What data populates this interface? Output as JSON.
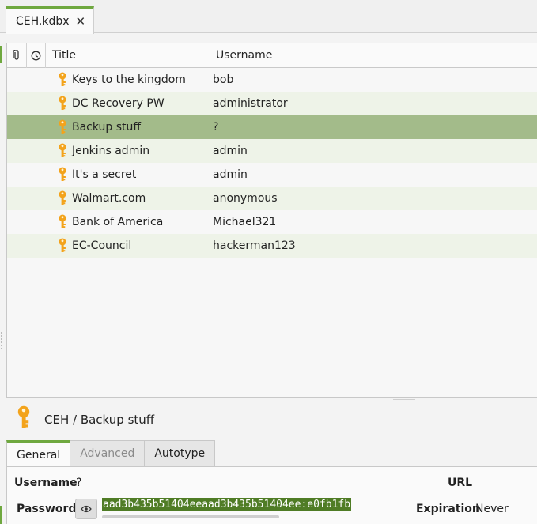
{
  "tab": {
    "title": "CEH.kdbx",
    "close_glyph": "✕"
  },
  "table": {
    "headers": {
      "title": "Title",
      "username": "Username"
    },
    "rows": [
      {
        "title": "Keys to the kingdom",
        "username": "bob"
      },
      {
        "title": "DC Recovery PW",
        "username": "administrator"
      },
      {
        "title": "Backup stuff",
        "username": "?"
      },
      {
        "title": "Jenkins admin",
        "username": "admin"
      },
      {
        "title": "It's a secret",
        "username": "admin"
      },
      {
        "title": "Walmart.com",
        "username": "anonymous"
      },
      {
        "title": "Bank of America",
        "username": "Michael321"
      },
      {
        "title": "EC-Council",
        "username": "hackerman123"
      }
    ],
    "selected_index": 2
  },
  "preview": {
    "breadcrumb": "CEH / Backup stuff",
    "tabs": [
      {
        "label": "General",
        "state": "active"
      },
      {
        "label": "Advanced",
        "state": "disabled"
      },
      {
        "label": "Autotype",
        "state": "normal"
      }
    ],
    "fields": {
      "username_label": "Username",
      "username_value": "?",
      "password_label": "Password",
      "password_value": "aad3b435b51404eeaad3b435b51404ee:e0fb1fb",
      "url_label": "URL",
      "expiration_label": "Expiration",
      "expiration_value": "Never"
    }
  },
  "icons": {
    "entry": "key-icon",
    "attachment_column": "paperclip-icon",
    "modified_column": "clock-icon",
    "reveal": "eye-icon"
  },
  "colors": {
    "accent": "#6fa83f",
    "selection": "#a3bb8a",
    "alt_row": "#eef3e8",
    "key": "#f3a31b",
    "password_bg": "#4f7c25"
  }
}
